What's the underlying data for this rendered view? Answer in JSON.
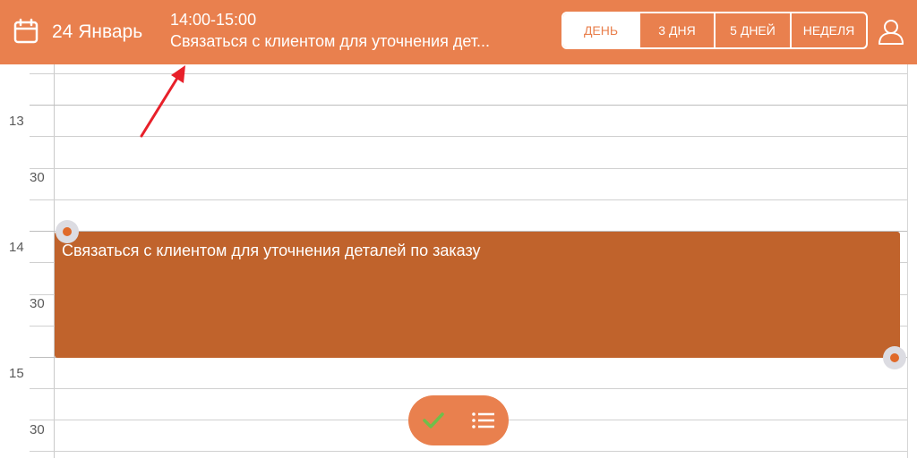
{
  "header": {
    "date": "24 Январь",
    "event_time": "14:00-15:00",
    "event_title": "Связаться с клиентом для уточнения дет...",
    "views": [
      {
        "label": "ДЕНЬ",
        "active": true
      },
      {
        "label": "3 ДНЯ",
        "active": false
      },
      {
        "label": "5 ДНЕЙ",
        "active": false
      },
      {
        "label": "НЕДЕЛЯ",
        "active": false
      }
    ],
    "calendar_icon": "calendar-icon",
    "user_icon": "user-icon"
  },
  "timeline": {
    "labels": [
      {
        "text": "13"
      },
      {
        "text": "30"
      },
      {
        "text": "14"
      },
      {
        "text": "30"
      },
      {
        "text": "15"
      },
      {
        "text": "30"
      }
    ]
  },
  "event": {
    "title": "Связаться с клиентом для уточнения деталей по заказу"
  },
  "fab": {
    "icons": [
      "check-icon",
      "list-icon"
    ]
  },
  "colors": {
    "header": "#e9804e",
    "event": "#c0632c",
    "annotation_arrow": "#e8202a"
  }
}
